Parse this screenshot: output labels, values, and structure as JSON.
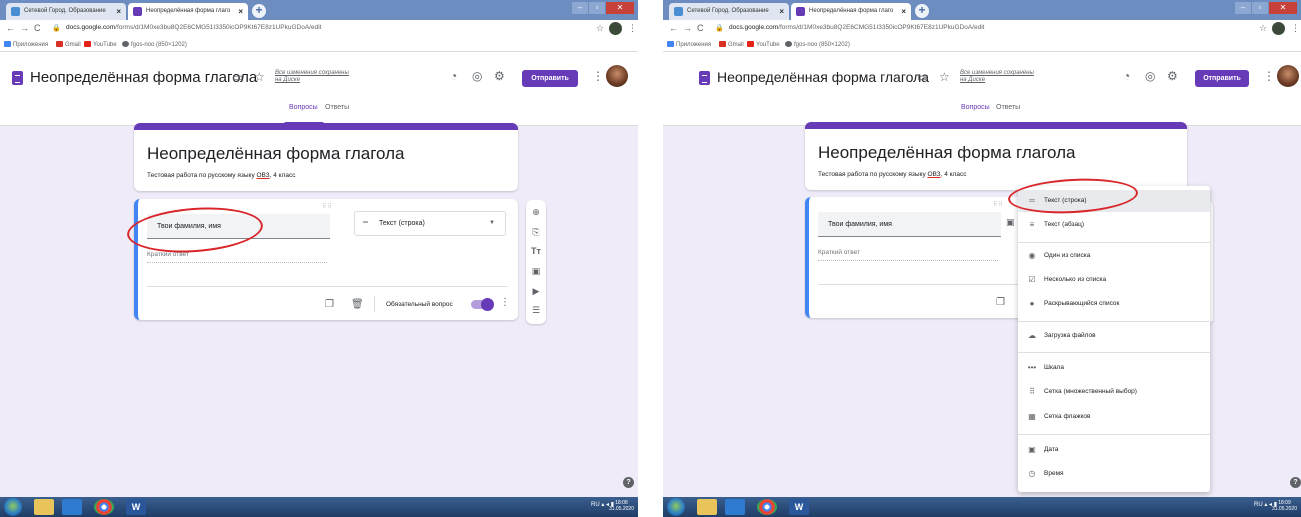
{
  "browser": {
    "tab1_title": "Сетевой Город. Образование",
    "tab2_title": "Неопределённая форма глаго",
    "close_glyph": "×",
    "new_tab_glyph": "+",
    "url_host": "docs.google.com",
    "url_path": "/forms/d/1M0xe3bu8Q2E6CMG51I3350icOP9Kt67E8z1UPkuGDoA/edit",
    "bookmarks": [
      "Приложения",
      "Gmail",
      "YouTube",
      "fgos-noo (850×1202)"
    ]
  },
  "header": {
    "doc_title": "Неопределённая форма глагола",
    "saved_line1": "Все изменения сохранены",
    "saved_line2": "на Диске",
    "send_label": "Отправить",
    "tab_questions": "Вопросы",
    "tab_answers": "Ответы"
  },
  "form": {
    "title": "Неопределённая форма глагола",
    "desc_pre": "Тестовая работа по русскому языку ",
    "desc_ovz": "ОВЗ",
    "desc_post": ", 4 класс"
  },
  "question": {
    "text": "Твои фамилия, имя",
    "type_label": "Текст (строка)",
    "short_answer": "Краткий ответ",
    "required_label": "Обязательный вопрос"
  },
  "type_menu": {
    "items": [
      "Текст (строка)",
      "Текст (абзац)",
      "Один из списка",
      "Несколько из списка",
      "Раскрывающийся список",
      "Загрузка файлов",
      "Шкала",
      "Сетка (множественный выбор)",
      "Сетка флажков",
      "Дата",
      "Время"
    ]
  },
  "taskbar": {
    "lang": "RU",
    "time_left": "18:08",
    "time_right": "18:09",
    "date": "31.05.2020"
  },
  "colors": {
    "accent": "#673ab7",
    "background": "#f0ebf8",
    "active_bar": "#4285f4",
    "annotation": "#d9262b"
  }
}
